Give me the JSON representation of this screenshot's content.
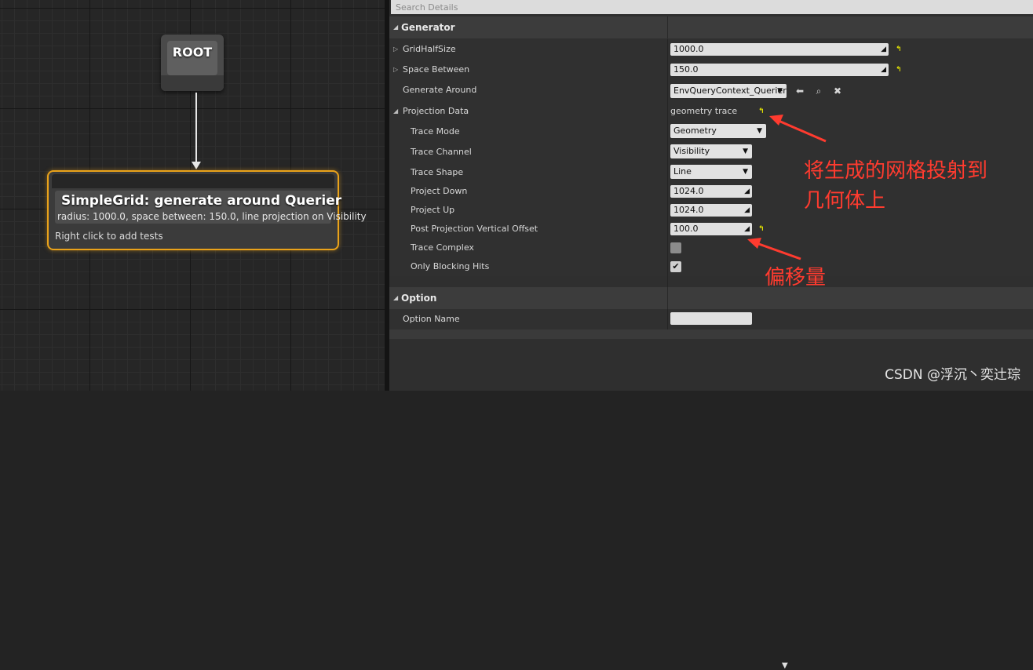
{
  "graph": {
    "root_label": "ROOT",
    "generator_node": {
      "title": "SimpleGrid: generate around Querier",
      "description": "radius: 1000.0, space between: 150.0, line projection on Visibility",
      "hint": "Right click to add tests"
    }
  },
  "details": {
    "search_placeholder": "Search Details",
    "categories": {
      "generator": "Generator",
      "option": "Option"
    },
    "rows": {
      "grid_half_size": {
        "label": "GridHalfSize",
        "value": "1000.0"
      },
      "space_between": {
        "label": "Space Between",
        "value": "150.0"
      },
      "generate_around": {
        "label": "Generate Around",
        "value": "EnvQueryContext_Querier"
      },
      "projection_data": {
        "label": "Projection Data",
        "value": "geometry trace"
      },
      "trace_mode": {
        "label": "Trace Mode",
        "value": "Geometry"
      },
      "trace_channel": {
        "label": "Trace Channel",
        "value": "Visibility"
      },
      "trace_shape": {
        "label": "Trace Shape",
        "value": "Line"
      },
      "project_down": {
        "label": "Project Down",
        "value": "1024.0"
      },
      "project_up": {
        "label": "Project Up",
        "value": "1024.0"
      },
      "post_projection_offset": {
        "label": "Post Projection Vertical Offset",
        "value": "100.0"
      },
      "trace_complex": {
        "label": "Trace Complex",
        "checked": false
      },
      "only_blocking_hits": {
        "label": "Only Blocking Hits",
        "checked": true
      },
      "option_name": {
        "label": "Option Name",
        "value": ""
      }
    }
  },
  "annotations": {
    "note1_line1": "将生成的网格投射到",
    "note1_line2": "几何体上",
    "note2": "偏移量",
    "color": "#ff3b2f"
  },
  "watermark": "CSDN @浮沉丶奕辻琮"
}
